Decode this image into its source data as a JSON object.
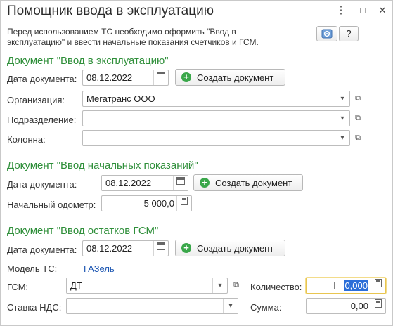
{
  "window": {
    "title": "Помощник ввода в эксплуатацию",
    "more_icon": "⋮",
    "maximize_icon": "□",
    "close_icon": "✕"
  },
  "info_text_line1": "Перед использованием ТС необходимо оформить \"Ввод в",
  "info_text_line2": "эксплуатацию\" и ввести начальные показания счетчиков и ГСМ.",
  "toolbar": {
    "help_label": "?"
  },
  "section1": {
    "title": "Документ \"Ввод в эксплуатацию\"",
    "date_label": "Дата документа:",
    "date_value": "08.12.2022",
    "create_label": "Создать документ",
    "org_label": "Организация:",
    "org_value": "Мегатранс ООО",
    "dept_label": "Подразделение:",
    "dept_value": "",
    "column_label": "Колонна:",
    "column_value": ""
  },
  "section2": {
    "title": "Документ \"Ввод начальных показаний\"",
    "date_label": "Дата документа:",
    "date_value": "08.12.2022",
    "create_label": "Создать документ",
    "odometer_label": "Начальный одометр:",
    "odometer_value": "5 000,0"
  },
  "section3": {
    "title": "Документ \"Ввод остатков ГСМ\"",
    "date_label": "Дата документа:",
    "date_value": "08.12.2022",
    "create_label": "Создать документ",
    "model_label": "Модель ТС:",
    "model_value": "ГАЗель",
    "fuel_label": "ГСМ:",
    "fuel_value": "ДТ",
    "qty_label": "Количество:",
    "qty_value": "0,000",
    "vat_label": "Ставка НДС:",
    "vat_value": "",
    "sum_label": "Сумма:",
    "sum_value": "0,00"
  },
  "colors": {
    "section_title": "#2f8f3a",
    "link": "#1f58b3",
    "add_icon": "#3aa74a",
    "focus_border": "#e8c550",
    "selection": "#2b6ed8"
  }
}
